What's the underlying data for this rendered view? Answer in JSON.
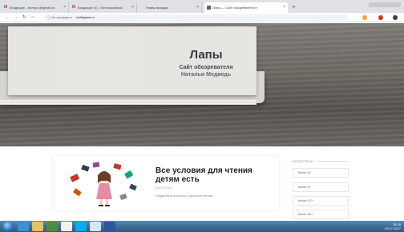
{
  "browser": {
    "tabs": [
      {
        "label": "Входящие - stcrng.lo@gmail.co",
        "icon": "gmail-icon"
      },
      {
        "label": "Входящие (1) - lichnsvaoutlook",
        "icon": "gmail-icon"
      },
      {
        "label": "Новая вкладка",
        "icon": "none"
      },
      {
        "label": "Лапы — Сайт обозревателя Н",
        "icon": "site-icon",
        "active": true
      }
    ],
    "new_tab_symbol": "+",
    "address": {
      "security_label": "Не защищено",
      "url": "lovillapawi.ru"
    }
  },
  "hero": {
    "title": "Лапы",
    "subtitle": "Сайт обозревателя",
    "author": "Натальи Медведь"
  },
  "post": {
    "title": "Все условия для чтения детям есть",
    "date": "03.07.2017",
    "excerpt": "Неудобные вопросы о детском чтении"
  },
  "sidebar": {
    "heading": "КАТЕГОРИИ",
    "categories": [
      "Книги 0+",
      "Книги 6+",
      "Книги 12+",
      "Книги 16+"
    ]
  },
  "taskbar": {
    "clock_time": "15:25",
    "clock_date": "03.07.2017"
  },
  "colors": {
    "tab_strip": "#dfe1e5",
    "taskbar": "#3d6d96",
    "hero_wood": "#6c6963"
  }
}
